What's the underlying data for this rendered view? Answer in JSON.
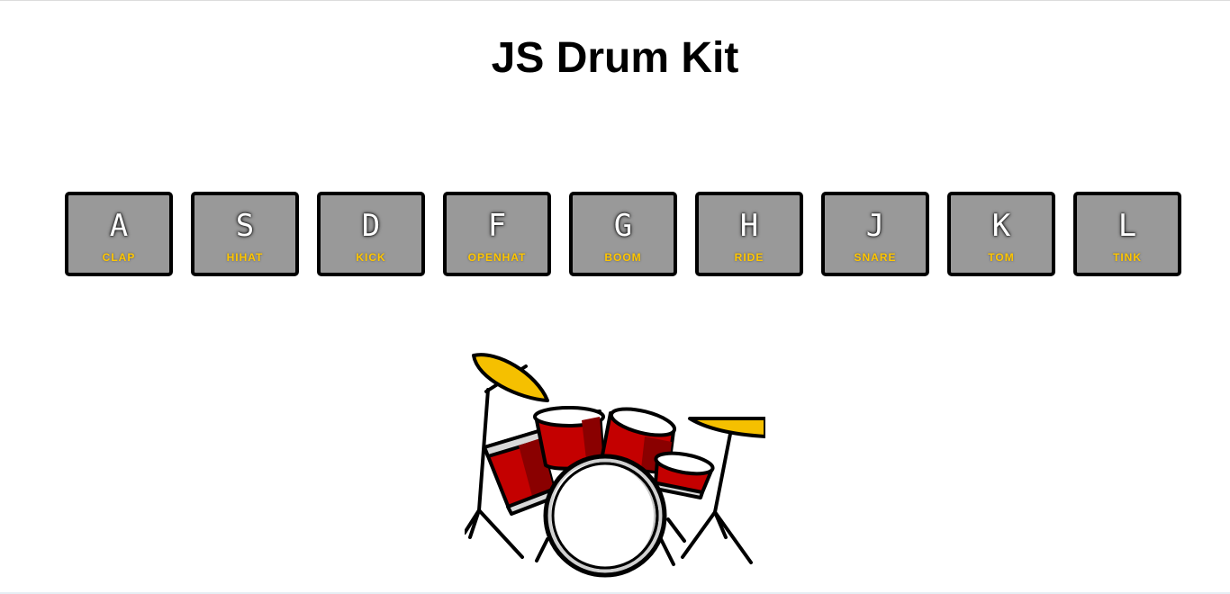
{
  "page": {
    "title": "JS Drum Kit"
  },
  "keys": [
    {
      "letter": "A",
      "sound": "CLAP"
    },
    {
      "letter": "S",
      "sound": "HIHAT"
    },
    {
      "letter": "D",
      "sound": "KICK"
    },
    {
      "letter": "F",
      "sound": "OPENHAT"
    },
    {
      "letter": "G",
      "sound": "BOOM"
    },
    {
      "letter": "H",
      "sound": "RIDE"
    },
    {
      "letter": "J",
      "sound": "SNARE"
    },
    {
      "letter": "K",
      "sound": "TOM"
    },
    {
      "letter": "L",
      "sound": "TINK"
    }
  ],
  "colors": {
    "key_background": "#999999",
    "key_border": "#000000",
    "sound_label": "#ffc600",
    "drum_red": "#c40000",
    "cymbal_yellow": "#f5c000"
  },
  "illustration": {
    "icon": "drum-kit-icon"
  }
}
